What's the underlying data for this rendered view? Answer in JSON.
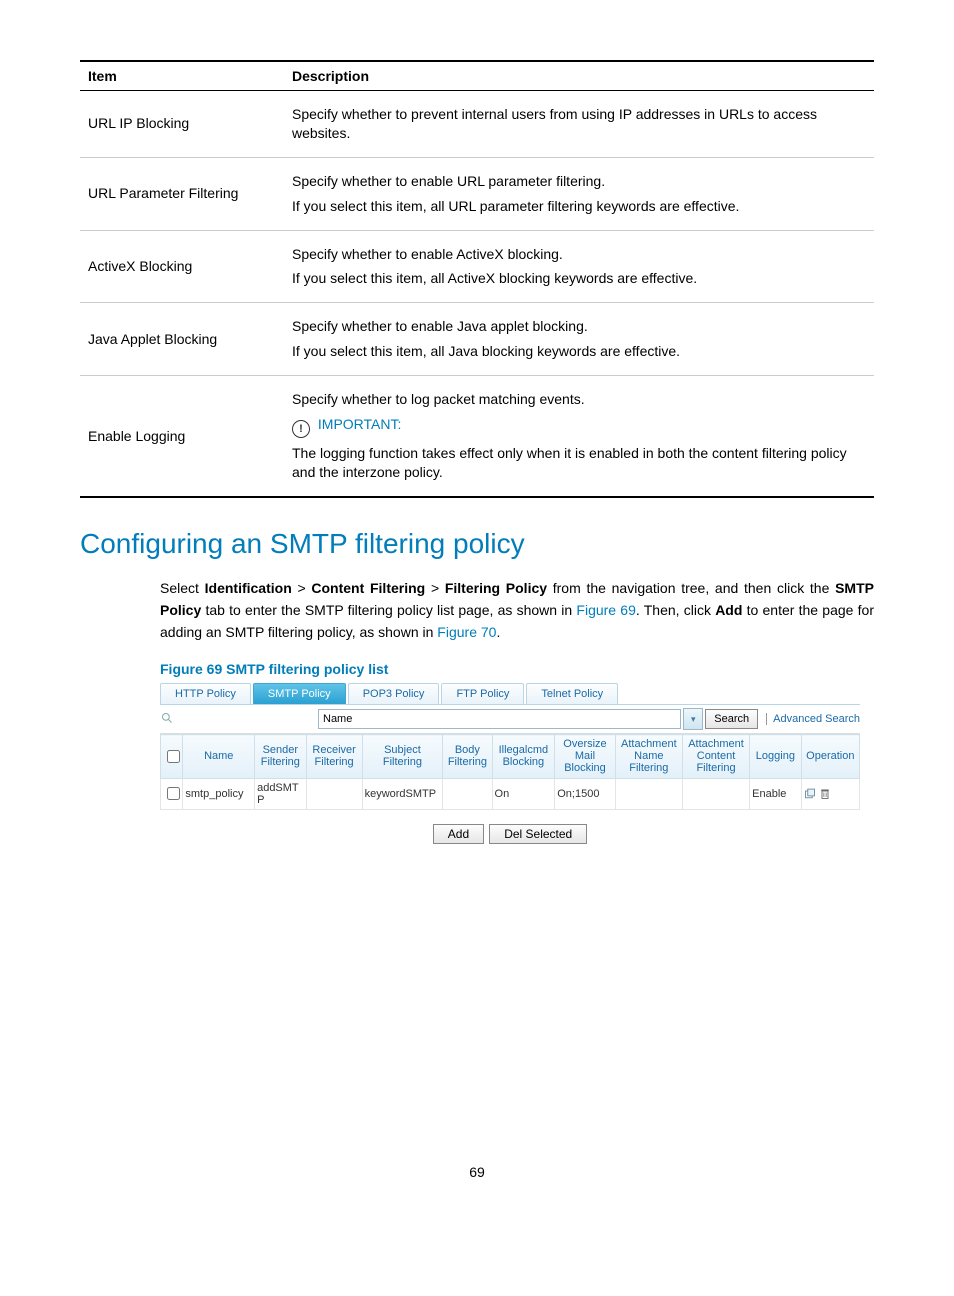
{
  "desc_table": {
    "headers": {
      "item": "Item",
      "description": "Description"
    },
    "rows": [
      {
        "item": "URL IP Blocking",
        "desc": [
          "Specify whether to prevent internal users from using IP addresses in URLs to access websites."
        ]
      },
      {
        "item": "URL Parameter Filtering",
        "desc": [
          "Specify whether to enable URL parameter filtering.",
          "If you select this item, all URL parameter filtering keywords are effective."
        ]
      },
      {
        "item": "ActiveX Blocking",
        "desc": [
          "Specify whether to enable ActiveX blocking.",
          "If you select this item, all ActiveX blocking keywords are effective."
        ]
      },
      {
        "item": "Java Applet Blocking",
        "desc": [
          "Specify whether to enable Java applet blocking.",
          "If you select this item, all Java blocking keywords are effective."
        ]
      },
      {
        "item": "Enable Logging",
        "desc_special": {
          "line1": "Specify whether to log packet matching events.",
          "important_label": "IMPORTANT:",
          "line2": "The logging function takes effect only when it is enabled in both the content filtering policy and the interzone policy."
        }
      }
    ]
  },
  "section_title": "Configuring an SMTP filtering policy",
  "para": {
    "p1a": "Select ",
    "p1b": "Identification",
    "p1c": " > ",
    "p1d": "Content Filtering",
    "p1e": " > ",
    "p1f": "Filtering Policy",
    "p1g": " from the navigation tree, and then click the ",
    "p1h": "SMTP Policy",
    "p1i": " tab to enter the SMTP filtering policy list page, as shown in ",
    "p1j": "Figure 69",
    "p1k": ". Then, click ",
    "p1l": "Add",
    "p1m": " to enter the page for adding an SMTP filtering policy, as shown in ",
    "p1n": "Figure 70",
    "p1o": "."
  },
  "figure_caption": "Figure 69 SMTP filtering policy list",
  "shot": {
    "tabs": [
      "HTTP Policy",
      "SMTP Policy",
      "POP3 Policy",
      "FTP Policy",
      "Telnet Policy"
    ],
    "active_tab": 1,
    "search": {
      "field_label": "Name",
      "search_btn": "Search",
      "advanced": "Advanced Search"
    },
    "grid": {
      "headers": [
        "Name",
        "Sender Filtering",
        "Receiver Filtering",
        "Subject Filtering",
        "Body Filtering",
        "Illegalcmd Blocking",
        "Oversize Mail Blocking",
        "Attachment Name Filtering",
        "Attachment Content Filtering",
        "Logging",
        "Operation"
      ],
      "row": {
        "name": "smtp_policy",
        "sender": "addSMTP",
        "receiver": "",
        "subject": "keywordSMTP",
        "body": "",
        "illegal": "On",
        "oversize": "On;1500",
        "attname": "",
        "attcontent": "",
        "logging": "Enable"
      }
    },
    "buttons": {
      "add": "Add",
      "del": "Del Selected"
    }
  },
  "page_number": "69"
}
